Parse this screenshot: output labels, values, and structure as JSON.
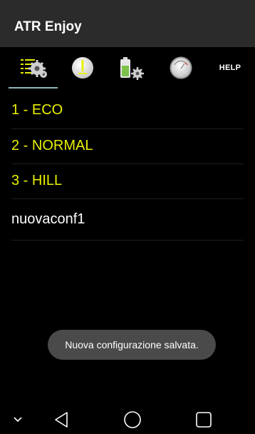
{
  "app": {
    "title": "ATR Enjoy"
  },
  "tabs": {
    "items": [
      {
        "name": "configurations",
        "icon": "settings-list-icon"
      },
      {
        "name": "alerts",
        "icon": "warning-circle-icon"
      },
      {
        "name": "battery-settings",
        "icon": "battery-gear-icon"
      },
      {
        "name": "gauge",
        "icon": "gauge-icon"
      },
      {
        "name": "help",
        "label": "HELP"
      }
    ],
    "selected_index": 0,
    "indicator_color": "#8fb7b8"
  },
  "configurations": [
    {
      "label": "1 - ECO",
      "color": "#e8f000"
    },
    {
      "label": "2 - NORMAL",
      "color": "#e8f000"
    },
    {
      "label": "3 - HILL",
      "color": "#e8f000"
    },
    {
      "label": "nuovaconf1",
      "color": "#ffffff"
    }
  ],
  "toast": {
    "message": "Nuova configurazione salvata."
  },
  "navbar": {
    "buttons": [
      "chevron-down-icon",
      "back-icon",
      "home-icon",
      "recents-icon"
    ]
  }
}
